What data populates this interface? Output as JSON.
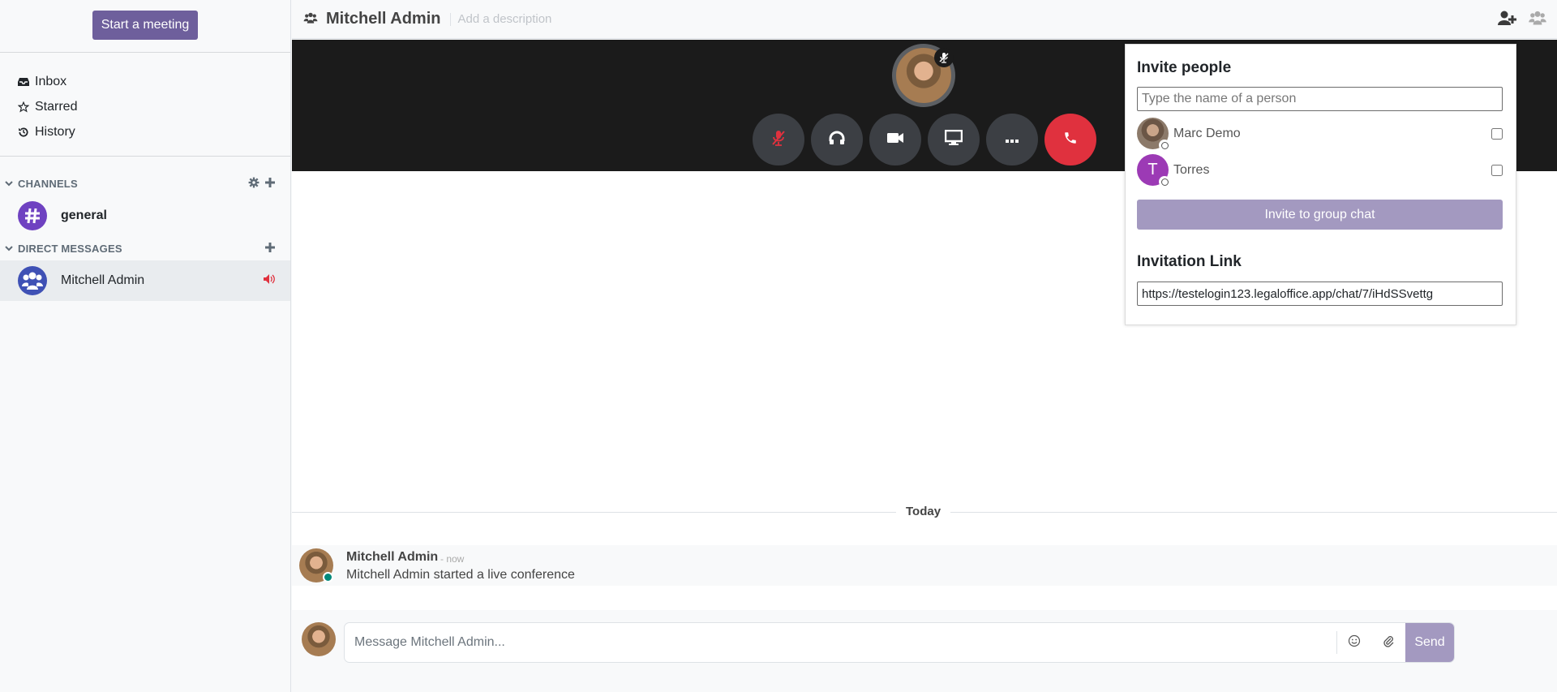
{
  "sidebar": {
    "start_meeting_label": "Start a meeting",
    "mailboxes": [
      {
        "label": "Inbox",
        "icon": "inbox-icon"
      },
      {
        "label": "Starred",
        "icon": "star-icon"
      },
      {
        "label": "History",
        "icon": "history-icon"
      }
    ],
    "channels": {
      "header": "CHANNELS",
      "items": [
        {
          "name": "general",
          "icon": "hashtag-icon"
        }
      ]
    },
    "direct_messages": {
      "header": "DIRECT MESSAGES",
      "items": [
        {
          "name": "Mitchell Admin",
          "icon": "group-icon",
          "status_icon": "volume-up-icon"
        }
      ]
    }
  },
  "header": {
    "title": "Mitchell Admin",
    "description_placeholder": "Add a description"
  },
  "call": {
    "controls": [
      "mute",
      "deafen",
      "camera",
      "share-screen",
      "more",
      "hang-up"
    ]
  },
  "invite": {
    "title": "Invite people",
    "search_placeholder": "Type the name of a person",
    "partners": [
      {
        "name": "Marc Demo",
        "initial": "",
        "checked": false
      },
      {
        "name": "Torres",
        "initial": "T",
        "checked": false
      }
    ],
    "invite_button": "Invite to group chat",
    "link_title": "Invitation Link",
    "link_value": "https://testelogin123.legaloffice.app/chat/7/iHdSSvettg"
  },
  "thread": {
    "separator": "Today",
    "messages": [
      {
        "author": "Mitchell Admin",
        "date": "- now",
        "body": "Mitchell Admin started a live conference"
      }
    ]
  },
  "composer": {
    "placeholder": "Message Mitchell Admin...",
    "send_label": "Send"
  },
  "colors": {
    "brand": "#6e5f9c",
    "brand_disabled": "#a399c0",
    "hangup": "#e0313e",
    "call_bg": "#1b1b1b",
    "channel_avatar": "#6f42c1",
    "dm_avatar": "#3f51b5",
    "torres_avatar": "#9c3ab5",
    "presence_online": "#00897b",
    "speaker_red": "#e0313e"
  }
}
